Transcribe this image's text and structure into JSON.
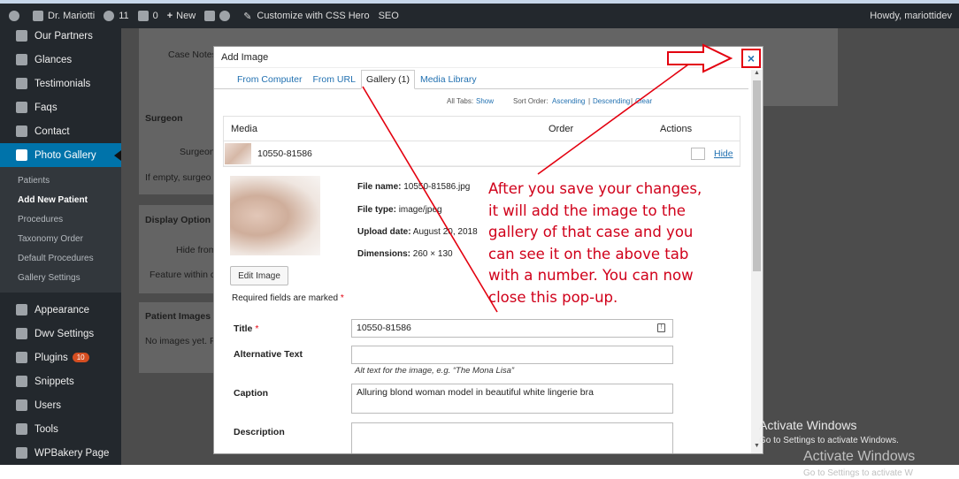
{
  "admin_bar": {
    "site_name": "Dr. Mariotti",
    "updates_count": "11",
    "comments_count": "0",
    "new_label": "New",
    "customize_label": "Customize with CSS Hero",
    "seo_label": "SEO",
    "howdy": "Howdy, mariottidev"
  },
  "sidebar": {
    "top_items": [
      {
        "label": "Our Partners"
      },
      {
        "label": "Glances"
      },
      {
        "label": "Testimonials"
      },
      {
        "label": "Faqs"
      },
      {
        "label": "Contact"
      },
      {
        "label": "Photo Gallery"
      }
    ],
    "submenu": [
      {
        "label": "Patients"
      },
      {
        "label": "Add New Patient"
      },
      {
        "label": "Procedures"
      },
      {
        "label": "Taxonomy Order"
      },
      {
        "label": "Default Procedures"
      },
      {
        "label": "Gallery Settings"
      }
    ],
    "bottom_items": [
      {
        "label": "Appearance"
      },
      {
        "label": "Dwv Settings"
      },
      {
        "label": "Plugins",
        "badge": "10"
      },
      {
        "label": "Snippets"
      },
      {
        "label": "Users"
      },
      {
        "label": "Tools"
      },
      {
        "label": "WPBakery Page"
      }
    ]
  },
  "background": {
    "case_notes": "Case Notes",
    "surgeon_title": "Surgeon",
    "surgeon_label": "Surgeon",
    "surgeon_help": "If empty, surgeo",
    "display_options_title": "Display Option",
    "hide_from": "Hide from",
    "feature_within": "Feature within c",
    "patient_images_title": "Patient Images",
    "no_images": "No images yet. P"
  },
  "modal": {
    "title": "Add Image",
    "close_label": "×",
    "tabs": [
      {
        "label": "From Computer"
      },
      {
        "label": "From URL"
      },
      {
        "label": "Gallery (1)"
      },
      {
        "label": "Media Library"
      }
    ],
    "sort": {
      "all_tabs": "All Tabs:",
      "show": "Show",
      "sort_order": "Sort Order:",
      "ascending": "Ascending",
      "separator": "|",
      "descending": "Descending",
      "clear": "Clear"
    },
    "table": {
      "col_media": "Media",
      "col_order": "Order",
      "col_actions": "Actions",
      "row_name": "10550-81586",
      "hide_link": "Hide"
    },
    "details": {
      "file_name_label": "File name:",
      "file_name": "10550-81586.jpg",
      "file_type_label": "File type:",
      "file_type": "image/jpeg",
      "upload_date_label": "Upload date:",
      "upload_date": "August 20, 2018",
      "dimensions_label": "Dimensions:",
      "dimensions": "260 × 130",
      "edit_button": "Edit Image",
      "required_note": "Required fields are marked",
      "star": "*"
    },
    "fields": {
      "title_label": "Title",
      "title_value": "10550-81586",
      "alt_label": "Alternative Text",
      "alt_value": "",
      "alt_help": "Alt text for the image, e.g. “The Mona Lisa”",
      "caption_label": "Caption",
      "caption_value": "Alluring blond woman model in beautiful white lingerie bra",
      "description_label": "Description",
      "description_value": ""
    }
  },
  "annotation": {
    "lines": [
      "After you save your changes,",
      "it will add the image to the",
      "gallery of that case and you",
      "can see it on the above tab",
      "with a number. You can now",
      "close this pop-up."
    ],
    "color": "#d0001a"
  },
  "watermark": {
    "title": "Activate Windows",
    "subtitle": "Go to Settings to activate Windows.",
    "title2": "Activate Windows",
    "subtitle2": "Go to Settings to activate W"
  }
}
